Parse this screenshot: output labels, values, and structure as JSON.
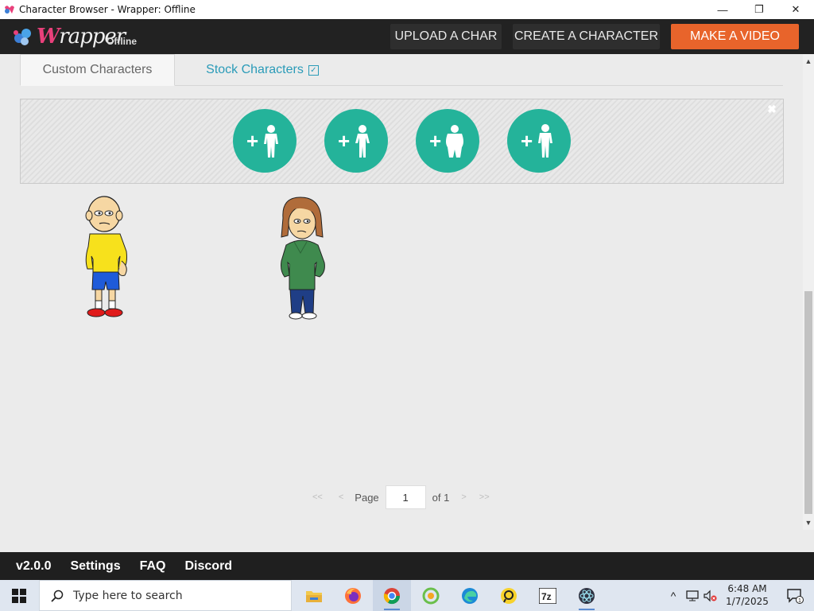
{
  "window": {
    "title": "Character Browser - Wrapper: Offline",
    "controls": {
      "minimize": "—",
      "maximize": "❐",
      "close": "✕"
    }
  },
  "header": {
    "logo_main": "rapper",
    "logo_cap": "W",
    "logo_sub": "Offline",
    "buttons": {
      "upload": "UPLOAD A CHAR",
      "create": "CREATE A CHARACTER",
      "video": "MAKE A VIDEO"
    },
    "accent": "#e8642b"
  },
  "tabs": {
    "custom": "Custom Characters",
    "stock": "Stock Characters"
  },
  "add_panel": {
    "close": "✖",
    "buttons": [
      {
        "label": "+",
        "icon": "add-standard-body-icon"
      },
      {
        "label": "+",
        "icon": "add-slim-body-icon"
      },
      {
        "label": "+",
        "icon": "add-heavy-body-icon"
      },
      {
        "label": "+",
        "icon": "add-long-body-icon"
      }
    ],
    "color": "#24b39a"
  },
  "characters": [
    {
      "name": "bald-character",
      "shirt": "#f7e11c",
      "shorts": "#1f5bd9",
      "shoes": "#e01a1a"
    },
    {
      "name": "brown-hair-character",
      "hoodie": "#3f8a4e",
      "pants": "#1f3e86",
      "hair": "#b06c3a"
    }
  ],
  "pager": {
    "first": "<<",
    "prev": "<",
    "page_label": "Page",
    "page_value": "1",
    "of_label": "of 1",
    "next": ">",
    "last": ">>"
  },
  "footer": {
    "version": "v2.0.0",
    "settings": "Settings",
    "faq": "FAQ",
    "discord": "Discord"
  },
  "taskbar": {
    "search_placeholder": "Type here to search",
    "time": "6:48 AM",
    "date": "1/7/2025",
    "notification_count": "1"
  }
}
